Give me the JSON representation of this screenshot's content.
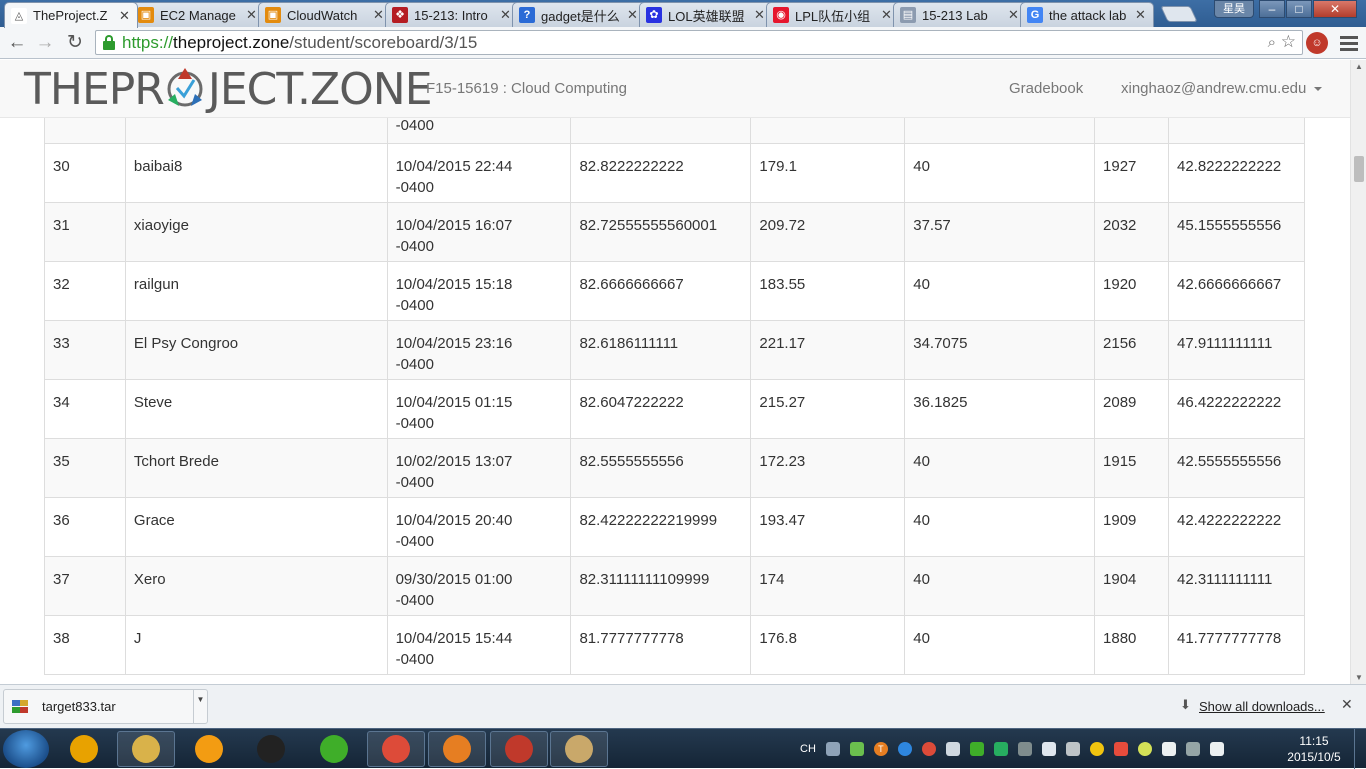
{
  "tabs": [
    {
      "label": "TheProject.Z",
      "icon": "theproject-favicon",
      "color": "#ffffff",
      "active": true
    },
    {
      "label": "EC2 Manage",
      "icon": "aws-favicon",
      "color": "#e38b0e"
    },
    {
      "label": "CloudWatch",
      "icon": "aws-favicon",
      "color": "#e38b0e"
    },
    {
      "label": "15-213: Intro",
      "icon": "cmu-favicon",
      "color": "#b51d23"
    },
    {
      "label": "gadget是什么",
      "icon": "baidu-zhidao-favicon",
      "color": "#2b6bd6"
    },
    {
      "label": "LOL英雄联盟",
      "icon": "baidu-paw-favicon",
      "color": "#2932e1"
    },
    {
      "label": "LPL队伍小组",
      "icon": "weibo-favicon",
      "color": "#e6162d"
    },
    {
      "label": "15-213 Lab",
      "icon": "document-favicon",
      "color": "#8c9bb0"
    },
    {
      "label": "the attack lab",
      "icon": "google-favicon",
      "color": "#4285f4"
    }
  ],
  "window": {
    "user_badge": "星昊",
    "minimize": "–",
    "maximize": "□",
    "close": "✕"
  },
  "toolbar": {
    "url_scheme": "https://",
    "url_host": "theproject.zone",
    "url_path": "/student/scoreboard/3/15"
  },
  "site": {
    "brand_left": "THEPR",
    "brand_right": "JECT.ZONE",
    "course": "F15-15619 : Cloud Computing",
    "nav_gradebook": "Gradebook",
    "nav_user": "xinghaoz@andrew.cmu.edu"
  },
  "table": {
    "partial_row": {
      "time_suffix": "-0400"
    },
    "rows": [
      {
        "rank": "30",
        "name": "baibai8",
        "date": "10/04/2015 22:44",
        "tz": "-0400",
        "score": "82.8222222222",
        "c4": "179.1",
        "c5": "40",
        "c6": "1927",
        "c7": "42.8222222222"
      },
      {
        "rank": "31",
        "name": "xiaoyige",
        "date": "10/04/2015 16:07",
        "tz": "-0400",
        "score": "82.72555555560001",
        "c4": "209.72",
        "c5": "37.57",
        "c6": "2032",
        "c7": "45.1555555556"
      },
      {
        "rank": "32",
        "name": "railgun",
        "date": "10/04/2015 15:18",
        "tz": "-0400",
        "score": "82.6666666667",
        "c4": "183.55",
        "c5": "40",
        "c6": "1920",
        "c7": "42.6666666667"
      },
      {
        "rank": "33",
        "name": "El Psy Congroo",
        "date": "10/04/2015 23:16",
        "tz": "-0400",
        "score": "82.6186111111",
        "c4": "221.17",
        "c5": "34.7075",
        "c6": "2156",
        "c7": "47.9111111111"
      },
      {
        "rank": "34",
        "name": "Steve",
        "date": "10/04/2015 01:15",
        "tz": "-0400",
        "score": "82.6047222222",
        "c4": "215.27",
        "c5": "36.1825",
        "c6": "2089",
        "c7": "46.4222222222"
      },
      {
        "rank": "35",
        "name": "Tchort Brede",
        "date": "10/02/2015 13:07",
        "tz": "-0400",
        "score": "82.5555555556",
        "c4": "172.23",
        "c5": "40",
        "c6": "1915",
        "c7": "42.5555555556"
      },
      {
        "rank": "36",
        "name": "Grace",
        "date": "10/04/2015 20:40",
        "tz": "-0400",
        "score": "82.42222222219999",
        "c4": "193.47",
        "c5": "40",
        "c6": "1909",
        "c7": "42.4222222222"
      },
      {
        "rank": "37",
        "name": "Xero",
        "date": "09/30/2015 01:00",
        "tz": "-0400",
        "score": "82.31111111109999",
        "c4": "174",
        "c5": "40",
        "c6": "1904",
        "c7": "42.3111111111"
      },
      {
        "rank": "38",
        "name": "J",
        "date": "10/04/2015 15:44",
        "tz": "-0400",
        "score": "81.7777777778",
        "c4": "176.8",
        "c5": "40",
        "c6": "1880",
        "c7": "41.7777777778"
      }
    ]
  },
  "downloads": {
    "file_name": "target833.tar",
    "show_all": "Show all downloads..."
  },
  "taskbar": {
    "apps": [
      {
        "name": "pinwheel-app-icon",
        "color": "#e8a200"
      },
      {
        "name": "file-explorer-icon",
        "color": "#d9b24a"
      },
      {
        "name": "headphones-app-icon",
        "color": "#f39c12"
      },
      {
        "name": "qq-penguin-icon",
        "color": "#222222"
      },
      {
        "name": "green-refresh-app-icon",
        "color": "#3fae29"
      },
      {
        "name": "chrome-icon",
        "color": "#dd4b39"
      },
      {
        "name": "remote-app-icon",
        "color": "#e67e22"
      },
      {
        "name": "pdf-reader-icon",
        "color": "#c0392b"
      },
      {
        "name": "photo-app-icon",
        "color": "#c9a86a"
      }
    ],
    "tray_lang": "CH",
    "time": "11:15",
    "date": "2015/10/5"
  }
}
